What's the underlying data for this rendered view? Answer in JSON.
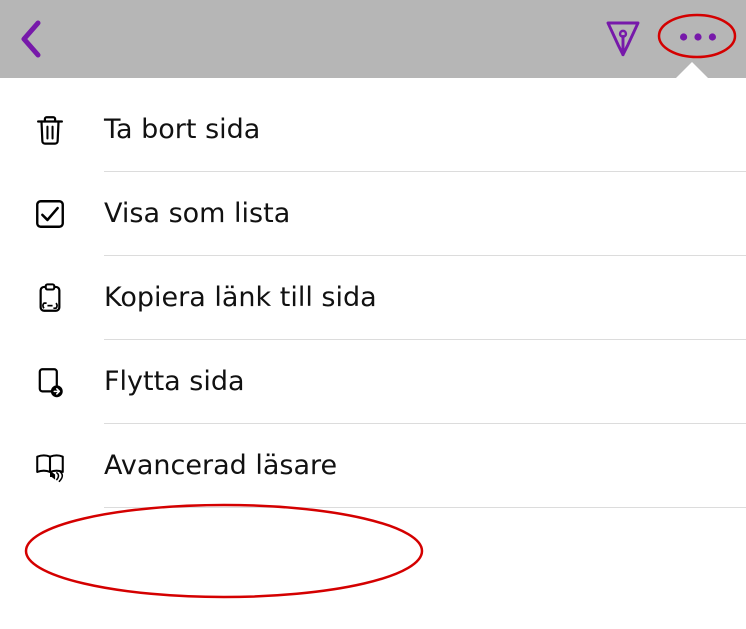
{
  "toolbar": {
    "back_label": "Tillbaka",
    "pen_label": "Penna",
    "more_label": "Mer",
    "accent_color": "#7719aa"
  },
  "menu": {
    "items": [
      {
        "label": "Ta bort sida"
      },
      {
        "label": "Visa som lista"
      },
      {
        "label": "Kopiera länk till sida"
      },
      {
        "label": "Flytta sida"
      },
      {
        "label": "Avancerad läsare"
      }
    ]
  },
  "annotations": {
    "highlight_color": "#d40000"
  }
}
